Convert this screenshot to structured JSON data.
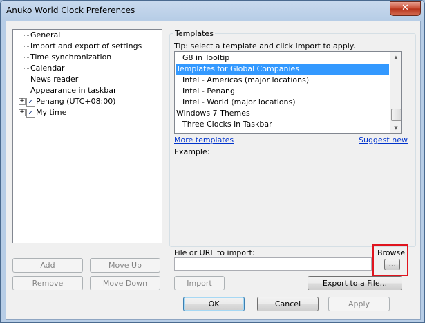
{
  "window": {
    "title": "Anuko World Clock Preferences",
    "close_glyph": "✕"
  },
  "tree": {
    "items": [
      {
        "label": "General"
      },
      {
        "label": "Import and export of settings"
      },
      {
        "label": "Time synchronization"
      },
      {
        "label": "Calendar"
      },
      {
        "label": "News reader"
      },
      {
        "label": "Appearance in taskbar"
      },
      {
        "label": "Penang (UTC+08:00)",
        "checked": true,
        "expander": "+"
      },
      {
        "label": "My time",
        "checked": true,
        "expander": "+"
      }
    ]
  },
  "left_buttons": {
    "add": "Add",
    "move_up": "Move Up",
    "remove": "Remove",
    "move_down": "Move Down"
  },
  "templates": {
    "group_label": "Templates",
    "tip": "Tip: select a template and click Import to apply.",
    "items": [
      {
        "label": "G8 in Tooltip",
        "indent": true
      },
      {
        "label": "Templates for Global Companies",
        "indent": false,
        "selected": true
      },
      {
        "label": "Intel - Americas (major locations)",
        "indent": true
      },
      {
        "label": "Intel - Penang",
        "indent": true
      },
      {
        "label": "Intel - World (major locations)",
        "indent": true
      },
      {
        "label": "Windows 7 Themes",
        "indent": false
      },
      {
        "label": "Three Clocks in Taskbar",
        "indent": true
      }
    ],
    "more_link": "More templates",
    "suggest_link": "Suggest new",
    "example_label": "Example:"
  },
  "import": {
    "file_label": "File or URL to import:",
    "value": "",
    "browse_label": "Browse",
    "browse_button": "...",
    "import_button": "Import",
    "export_button": "Export to a File..."
  },
  "dialog_buttons": {
    "ok": "OK",
    "cancel": "Cancel",
    "apply": "Apply"
  },
  "colors": {
    "selection": "#3399ff",
    "link": "#0033cc",
    "highlight_box": "#e0141e"
  }
}
